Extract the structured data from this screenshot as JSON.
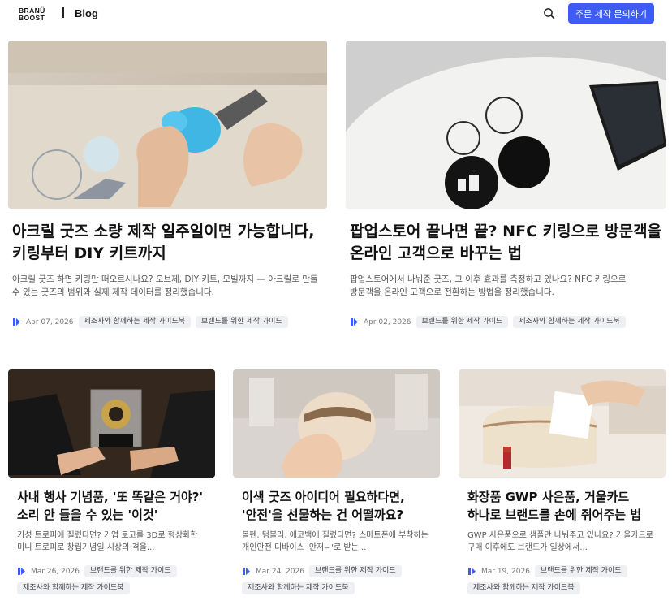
{
  "header": {
    "logo_top": "BRANÜ",
    "logo_bottom": "BOOST",
    "blog_label": "Blog",
    "search_icon": "search-icon",
    "cta_label": "주문 제작 문의하기",
    "accent_color": "#3f5bf6"
  },
  "featured": [
    {
      "title": "아크릴 굿즈 소량 제작 일주일이면 가능합니다, 키링부터 DIY 키트까지",
      "description": "아크릴 굿즈 하면 키링만 떠오르시나요? 오브제, DIY 키트, 모빌까지 — 아크릴로 만들 수 있는 굿즈의 범위와 실제 제작 데이터를 정리했습니다.",
      "date": "Apr 07, 2026",
      "tags": [
        "제조사와 함께하는 제작 가이드북",
        "브랜드를 위한 제작 가이드"
      ],
      "image": "acrylic-keyring-photo"
    },
    {
      "title": "팝업스토어 끝나면 끝? NFC 키링으로 방문객을 온라인 고객으로 바꾸는 법",
      "description": "팝업스토어에서 나눠준 굿즈, 그 이후 효과를 측정하고 있나요? NFC 키링으로 방문객을 온라인 고객으로 전환하는 방법을 정리했습니다.",
      "date": "Apr 02, 2026",
      "tags": [
        "브랜드를 위한 제작 가이드",
        "제조사와 함께하는 제작 가이드북"
      ],
      "image": "nfc-keyring-photo"
    }
  ],
  "posts": [
    {
      "title": "사내 행사 기념품, '또 똑같은 거야?' 소리 안 들을 수 있는 '이것'",
      "description": "기성 트로피에 질렸다면? 기업 로고를 3D로 형상화한 미니 트로피로 창립기념일 시상의 격을...",
      "date": "Mar 26, 2026",
      "tags": [
        "브랜드를 위한 제작 가이드",
        "제조사와 함께하는 제작 가이드북"
      ],
      "image": "trophy-photo"
    },
    {
      "title": "이색 굿즈 아이디어 필요하다면, '안전'을 선물하는 건 어떨까요?",
      "description": "볼펜, 텀블러, 에코백에 질렸다면? 스마트폰에 부착하는 개인안전 디바이스 '안저니'로 받는...",
      "date": "Mar 24, 2026",
      "tags": [
        "브랜드를 위한 제작 가이드",
        "제조사와 함께하는 제작 가이드북"
      ],
      "image": "safety-device-photo"
    },
    {
      "title": "화장품 GWP 사은품, 거울카드 하나로 브랜드를 손에 쥐어주는 법",
      "description": "GWP 사은품으로 샘플만 나눠주고 있나요? 거울카드로 구매 이후에도 브랜드가 일상에서...",
      "date": "Mar 19, 2026",
      "tags": [
        "브랜드를 위한 제작 가이드",
        "제조사와 함께하는 제작 가이드북"
      ],
      "image": "mirror-card-photo"
    }
  ]
}
